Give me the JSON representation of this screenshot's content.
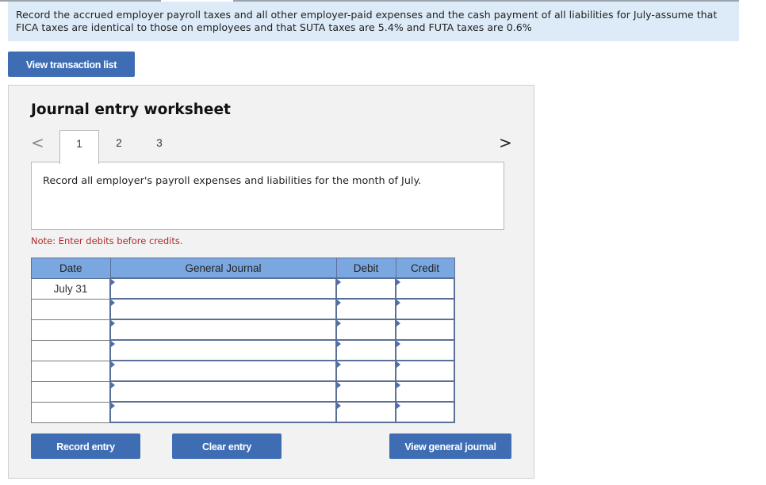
{
  "question": {
    "text": "Record the accrued employer payroll taxes and all other employer-paid expenses and the cash payment of all liabilities for July-assume that FICA taxes are identical to those on employees and that SUTA taxes are 5.4% and FUTA taxes are 0.6%"
  },
  "buttons": {
    "view_transaction_list": "View transaction list",
    "record_entry": "Record entry",
    "clear_entry": "Clear entry",
    "view_general_journal": "View general journal"
  },
  "worksheet": {
    "title": "Journal entry worksheet",
    "prev_icon": "chevron-left",
    "next_icon": "chevron-right",
    "prev_glyph": "<",
    "next_glyph": ">",
    "tabs": [
      {
        "label": "1",
        "active": true
      },
      {
        "label": "2",
        "active": false
      },
      {
        "label": "3",
        "active": false
      }
    ],
    "description": "Record all employer's payroll expenses and liabilities for the month of July.",
    "note": "Note: Enter debits before credits."
  },
  "journal": {
    "headers": {
      "date": "Date",
      "general_journal": "General Journal",
      "debit": "Debit",
      "credit": "Credit"
    },
    "rows": [
      {
        "date": "July 31",
        "account": "",
        "debit": "",
        "credit": ""
      },
      {
        "date": "",
        "account": "",
        "debit": "",
        "credit": ""
      },
      {
        "date": "",
        "account": "",
        "debit": "",
        "credit": ""
      },
      {
        "date": "",
        "account": "",
        "debit": "",
        "credit": ""
      },
      {
        "date": "",
        "account": "",
        "debit": "",
        "credit": ""
      },
      {
        "date": "",
        "account": "",
        "debit": "",
        "credit": ""
      },
      {
        "date": "",
        "account": "",
        "debit": "",
        "credit": ""
      }
    ]
  },
  "colors": {
    "button_bg": "#3f6db4",
    "question_bg": "#dcebf7",
    "table_header_bg": "#7ba7e0",
    "note_color": "#b02a2a"
  }
}
